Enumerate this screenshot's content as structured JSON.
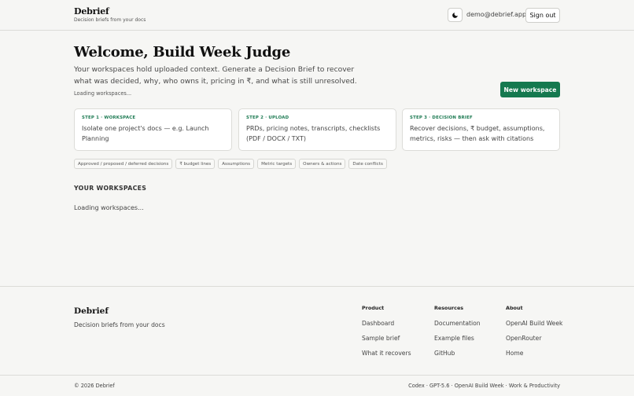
{
  "header": {
    "brand_name": "Debrief",
    "brand_tagline": "Decision briefs from your docs",
    "theme_icon": "moon-icon",
    "user_email": "demo@debrief.app",
    "signout_label": "Sign out"
  },
  "main": {
    "title": "Welcome, Build Week Judge",
    "intro": "Your workspaces hold uploaded context. Generate a Decision Brief to recover what was decided, why, who owns it, pricing in ₹, and what is still unresolved.",
    "loading_small": "Loading workspaces...",
    "new_workspace_label": "New workspace",
    "steps": [
      {
        "label": "STEP 1 · WORKSPACE",
        "text": "Isolate one project's docs — e.g. Launch Planning"
      },
      {
        "label": "STEP 2 · UPLOAD",
        "text": "PRDs, pricing notes, transcripts, checklists (PDF / DOCX / TXT)"
      },
      {
        "label": "STEP 3 · DECISION BRIEF",
        "text": "Recover decisions, ₹ budget, assumptions, metrics, risks — then ask with citations"
      }
    ],
    "chips": [
      "Approved / proposed / deferred decisions",
      "₹ budget lines",
      "Assumptions",
      "Metric targets",
      "Owners & actions",
      "Date conflicts"
    ],
    "section_title": "YOUR WORKSPACES",
    "loading_main": "Loading workspaces..."
  },
  "footer": {
    "brand_name": "Debrief",
    "brand_tagline": "Decision briefs from your docs",
    "columns": [
      {
        "title": "Product",
        "links": [
          "Dashboard",
          "Sample brief",
          "What it recovers"
        ]
      },
      {
        "title": "Resources",
        "links": [
          "Documentation",
          "Example files",
          "GitHub"
        ]
      },
      {
        "title": "About",
        "links": [
          "OpenAI Build Week",
          "OpenRouter",
          "Home"
        ]
      }
    ],
    "copyright": "© 2026 Debrief",
    "credits": "Codex · GPT-5.6 · OpenAI Build Week · Work & Productivity"
  },
  "colors": {
    "accent": "#15794f",
    "background": "#f6f6f4",
    "card": "#ffffff"
  }
}
